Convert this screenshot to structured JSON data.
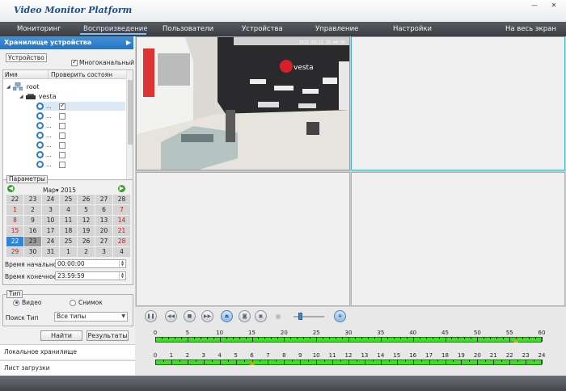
{
  "window": {
    "title": "Video Monitor Platform",
    "minimize": "—",
    "close": "✕"
  },
  "menu": [
    {
      "label": "Мониторинг"
    },
    {
      "label": "Воспроизведение"
    },
    {
      "label": "Пользователи"
    },
    {
      "label": "Устройства"
    },
    {
      "label": "Управление"
    },
    {
      "label": "Настройки"
    },
    {
      "label": "На весь экран"
    }
  ],
  "active_menu": "Воспроизведение",
  "sidebar": {
    "header": "Хранилище устройства",
    "device_tab": "Устройство",
    "multichannel_label": "Многоканальный",
    "multichannel_checked": true,
    "tree_columns": {
      "name": "Имя",
      "check": "Проверить состоян"
    },
    "root_label": "root",
    "device_label": "vesta",
    "channels": [
      {
        "label": "...",
        "checked": true
      },
      {
        "label": "...",
        "checked": false
      },
      {
        "label": "...",
        "checked": false
      },
      {
        "label": "...",
        "checked": false
      },
      {
        "label": "...",
        "checked": false
      },
      {
        "label": "...",
        "checked": false
      },
      {
        "label": "...",
        "checked": false
      }
    ]
  },
  "params": {
    "group_label": "Параметры",
    "month": "Мар▾",
    "year": "2015",
    "prev": "◀",
    "next": "▶",
    "weeks": [
      [
        "22",
        "23",
        "24",
        "25",
        "26",
        "27",
        "28"
      ],
      [
        "1",
        "2",
        "3",
        "4",
        "5",
        "6",
        "7"
      ],
      [
        "8",
        "9",
        "10",
        "11",
        "12",
        "13",
        "14"
      ],
      [
        "15",
        "16",
        "17",
        "18",
        "19",
        "20",
        "21"
      ],
      [
        "22",
        "23",
        "24",
        "25",
        "26",
        "27",
        "28"
      ],
      [
        "29",
        "30",
        "31",
        "1",
        "2",
        "3",
        "4"
      ]
    ],
    "start_label": "Время начально",
    "start_value": "00:00:00",
    "end_label": "Время конечное",
    "end_value": "23:59:59"
  },
  "type_group": {
    "label": "Тип",
    "video": "Видео",
    "snapshot": "Снимок",
    "selected": "video",
    "search_label": "Поиск Тип",
    "search_value": "Все типы"
  },
  "buttons": {
    "find": "Найти",
    "results": "Результаты"
  },
  "bottom_nav": [
    {
      "label": "Локальное хранилище"
    },
    {
      "label": "Лист загрузки"
    }
  ],
  "video": {
    "osd": "2015-03-22 16:44:06",
    "brand_text": "vesta"
  },
  "timeline": {
    "minutes": [
      "0",
      "5",
      "10",
      "15",
      "20",
      "25",
      "30",
      "35",
      "40",
      "45",
      "50",
      "55",
      "60"
    ],
    "hours": [
      "0",
      "1",
      "2",
      "3",
      "4",
      "5",
      "6",
      "7",
      "8",
      "9",
      "10",
      "11",
      "12",
      "13",
      "14",
      "15",
      "16",
      "17",
      "18",
      "19",
      "20",
      "21",
      "22",
      "23",
      "24"
    ],
    "minute_marker": 56,
    "hour_marker": 6,
    "volume_level": 0.2
  },
  "colors": {
    "accent": "#2a72c0",
    "today": "#2e84de",
    "record": "#3ee023",
    "weekend": "#e01010"
  }
}
